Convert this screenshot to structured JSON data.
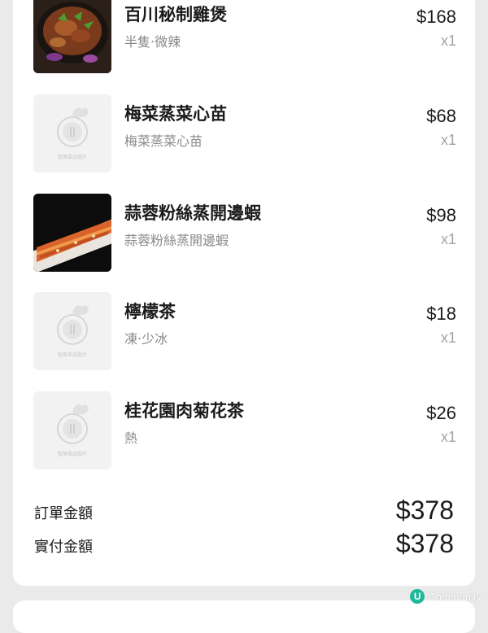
{
  "order": {
    "items": [
      {
        "name": "百川秘制雞煲",
        "option": "半隻‧微辣",
        "price": "$168",
        "qty": "x1",
        "image": "photo"
      },
      {
        "name": "梅菜蒸菜心苗",
        "option": "梅菜蒸菜心苗",
        "price": "$68",
        "qty": "x1",
        "image": "placeholder"
      },
      {
        "name": "蒜蓉粉絲蒸開邊蝦",
        "option": "蒜蓉粉絲蒸開邊蝦",
        "price": "$98",
        "qty": "x1",
        "image": "photo"
      },
      {
        "name": "檸檬茶",
        "option": "凍‧少冰",
        "price": "$18",
        "qty": "x1",
        "image": "placeholder"
      },
      {
        "name": "桂花園肉菊花茶",
        "option": "熱",
        "price": "$26",
        "qty": "x1",
        "image": "placeholder"
      }
    ],
    "placeholder_text": "暫無菜品圖片",
    "summary": {
      "order_amount_label": "訂單金額",
      "order_amount_value": "$378",
      "paid_amount_label": "實付金額",
      "paid_amount_value": "$378"
    }
  },
  "watermark": {
    "logo": "U",
    "text": "Community"
  }
}
